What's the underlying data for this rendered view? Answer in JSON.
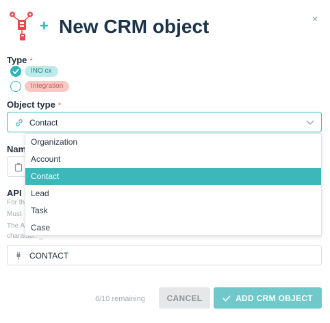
{
  "header": {
    "title": "New CRM object",
    "plus": "+",
    "close": "×",
    "logo_icon": "crm-objects-logo-icon"
  },
  "form": {
    "type_label": "Type",
    "required_mark": "*",
    "type_options": [
      {
        "label": "INO cx",
        "checked": true,
        "color": "#bfeaea"
      },
      {
        "label": "Integration",
        "checked": false,
        "color": "#f8c8c4"
      }
    ],
    "object_type_label": "Object type",
    "object_type_value": "Contact",
    "object_type_options": [
      "Organization",
      "Account",
      "Contact",
      "Lead",
      "Task",
      "Case"
    ],
    "object_type_selected": "Contact",
    "name_label_partial": "Nam",
    "api_label_partial": "API n",
    "hint_lines": [
      "For th",
      "Must",
      "The A",
      "character: _"
    ],
    "api_value": "CONTACT"
  },
  "footer": {
    "remaining": "6/10 remaining",
    "cancel_label": "CANCEL",
    "add_label": "ADD CRM OBJECT"
  },
  "colors": {
    "accent": "#3cb8ba",
    "title": "#1c3349",
    "required": "#e05b5b"
  }
}
